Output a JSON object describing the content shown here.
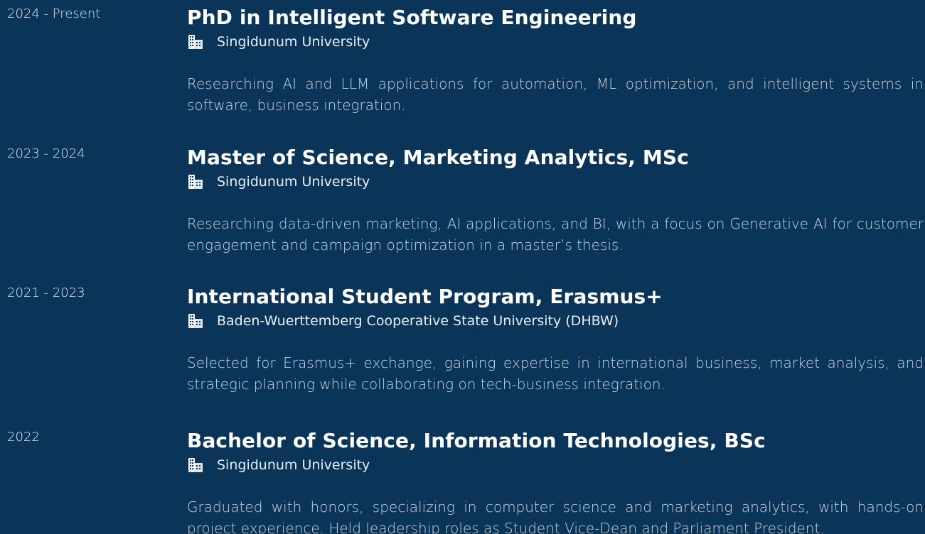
{
  "education": [
    {
      "date": "2024 - Present",
      "title": "PhD in Intelligent Software Engineering",
      "institution": "Singidunum University",
      "description": "Researching AI and LLM applications for automation, ML optimization, and intelligent systems in software, business integration."
    },
    {
      "date": "2023 - 2024",
      "title": "Master of Science, Marketing Analytics, MSc",
      "institution": "Singidunum University",
      "description": "Researching data-driven marketing, AI applications, and BI, with a focus on Generative AI for customer engagement and campaign optimization in a master’s thesis."
    },
    {
      "date": "2021 - 2023",
      "title": "International Student Program, Erasmus+",
      "institution": "Baden-Wuerttemberg Cooperative State University (DHBW)",
      "description": "Selected for Erasmus+ exchange, gaining expertise in international business, market analysis, and strategic planning while collaborating on tech-business integration."
    },
    {
      "date": "2022",
      "title": "Bachelor of Science, Information Technologies, BSc",
      "institution": "Singidunum University",
      "description": "Graduated with honors, specializing in computer science and marketing analytics, with hands-on project experience. Held leadership roles as Student Vice-Dean and Parliament President."
    }
  ],
  "icons": {
    "institution": "building-icon"
  },
  "colors": {
    "background": "#0b3558",
    "title": "#ffffff",
    "text": "#c7d4e0"
  }
}
